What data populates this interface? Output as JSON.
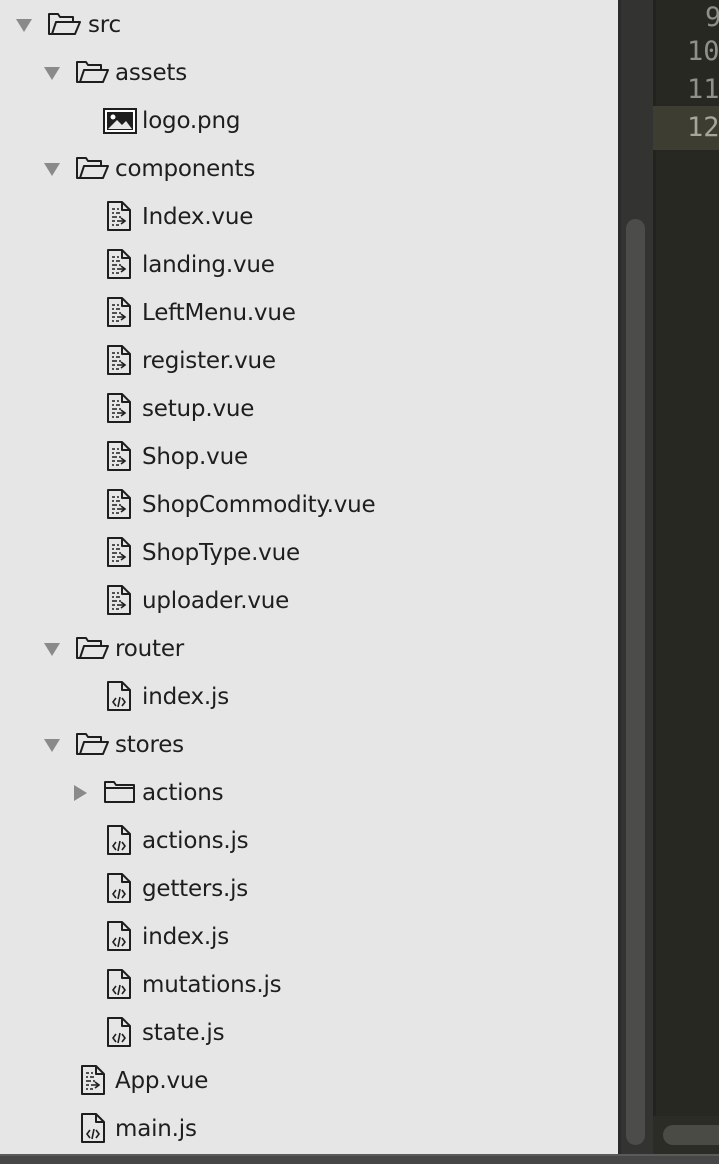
{
  "tree": [
    {
      "label": "src",
      "type": "folder",
      "state": "expanded",
      "depth": 0
    },
    {
      "label": "assets",
      "type": "folder",
      "state": "expanded",
      "depth": 1
    },
    {
      "label": "logo.png",
      "type": "image",
      "depth": 2
    },
    {
      "label": "components",
      "type": "folder",
      "state": "expanded",
      "depth": 1
    },
    {
      "label": "Index.vue",
      "type": "vue",
      "depth": 2
    },
    {
      "label": "landing.vue",
      "type": "vue",
      "depth": 2
    },
    {
      "label": "LeftMenu.vue",
      "type": "vue",
      "depth": 2
    },
    {
      "label": "register.vue",
      "type": "vue",
      "depth": 2
    },
    {
      "label": "setup.vue",
      "type": "vue",
      "depth": 2
    },
    {
      "label": "Shop.vue",
      "type": "vue",
      "depth": 2
    },
    {
      "label": "ShopCommodity.vue",
      "type": "vue",
      "depth": 2
    },
    {
      "label": "ShopType.vue",
      "type": "vue",
      "depth": 2
    },
    {
      "label": "uploader.vue",
      "type": "vue",
      "depth": 2
    },
    {
      "label": "router",
      "type": "folder",
      "state": "expanded",
      "depth": 1
    },
    {
      "label": "index.js",
      "type": "js",
      "depth": 2
    },
    {
      "label": "stores",
      "type": "folder",
      "state": "expanded",
      "depth": 1
    },
    {
      "label": "actions",
      "type": "folder",
      "state": "collapsed",
      "depth": 2
    },
    {
      "label": "actions.js",
      "type": "js",
      "depth": 2
    },
    {
      "label": "getters.js",
      "type": "js",
      "depth": 2
    },
    {
      "label": "index.js",
      "type": "js",
      "depth": 2
    },
    {
      "label": "mutations.js",
      "type": "js",
      "depth": 2
    },
    {
      "label": "state.js",
      "type": "js",
      "depth": 2
    },
    {
      "label": "App.vue",
      "type": "vue",
      "depth": 1
    },
    {
      "label": "main.js",
      "type": "js",
      "depth": 1
    }
  ],
  "icons": {
    "folder": "folder-icon",
    "image": "image-file-icon",
    "vue": "vue-file-icon",
    "js": "js-file-icon",
    "expanded": "triangle-down-icon",
    "collapsed": "triangle-right-icon"
  },
  "editor": {
    "line_numbers": [
      "9",
      "10",
      "11",
      "12"
    ],
    "current_line": "12"
  },
  "colors": {
    "sidebar_bg": "#e6e6e6",
    "editor_bg": "#272822",
    "line_number": "#8f908a",
    "current_line_bg": "#3e3d32"
  }
}
